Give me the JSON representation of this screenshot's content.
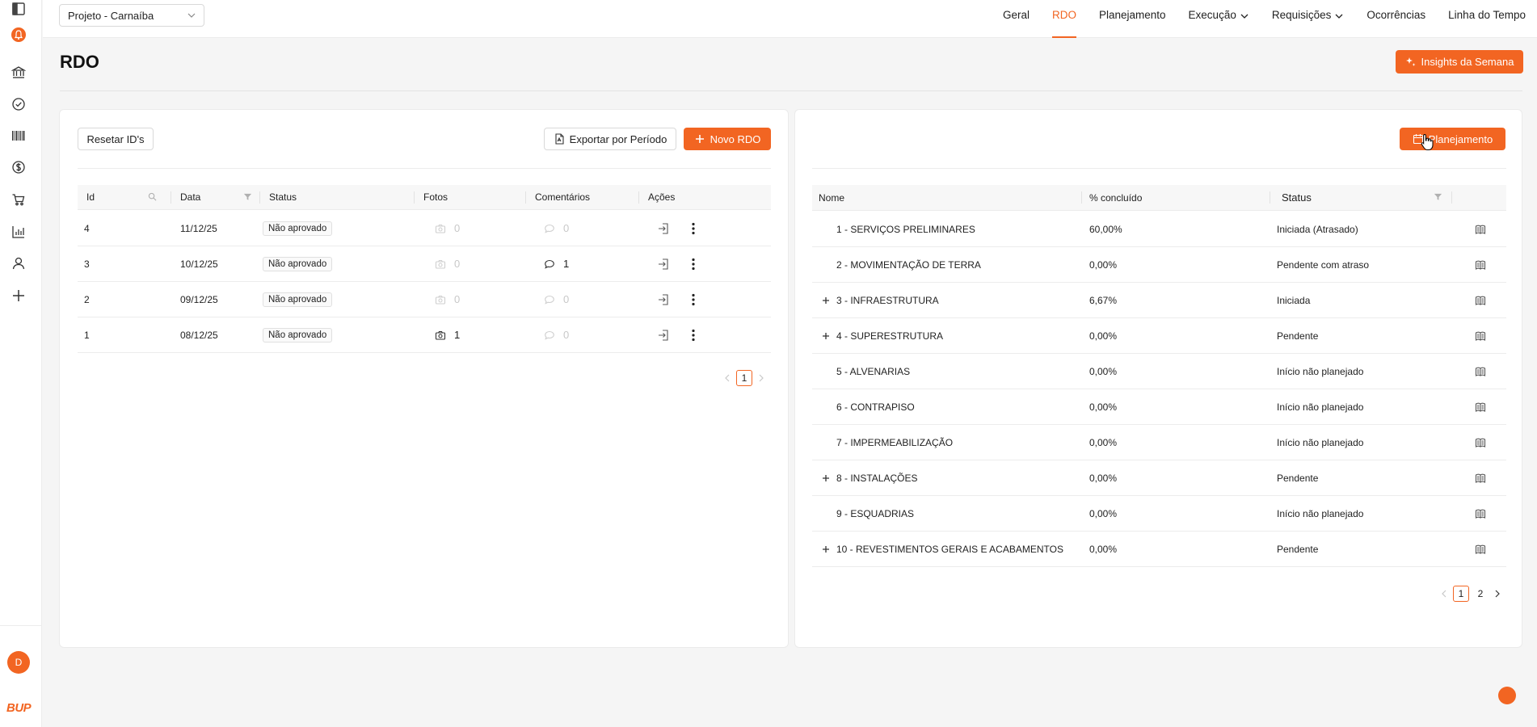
{
  "topbar": {
    "project": "Projeto - Carnaíba",
    "nav": [
      {
        "label": "Geral",
        "active": false,
        "dropdown": false
      },
      {
        "label": "RDO",
        "active": true,
        "dropdown": false
      },
      {
        "label": "Planejamento",
        "active": false,
        "dropdown": false
      },
      {
        "label": "Execução",
        "active": false,
        "dropdown": true
      },
      {
        "label": "Requisições",
        "active": false,
        "dropdown": true
      },
      {
        "label": "Ocorrências",
        "active": false,
        "dropdown": false
      },
      {
        "label": "Linha do Tempo",
        "active": false,
        "dropdown": false
      }
    ]
  },
  "sidebar": {
    "icons": [
      "panel-toggle-icon",
      "alert-bell-icon",
      "bank-icon",
      "check-circle-icon",
      "barcode-icon",
      "dollar-icon",
      "cart-icon",
      "bar-chart-icon",
      "user-icon",
      "plus-icon"
    ],
    "avatar_initial": "D",
    "logo_text": "BUP"
  },
  "page": {
    "title": "RDO",
    "insights_label": "Insights da Semana"
  },
  "rdo_panel": {
    "reset_label": "Resetar ID's",
    "export_label": "Exportar por Período",
    "new_label": "Novo RDO",
    "columns": [
      "Id",
      "Data",
      "Status",
      "Fotos",
      "Comentários",
      "Ações"
    ],
    "rows": [
      {
        "id": "4",
        "date": "11/12/25",
        "status": "Não aprovado",
        "photos": "0",
        "comments": "0"
      },
      {
        "id": "3",
        "date": "10/12/25",
        "status": "Não aprovado",
        "photos": "0",
        "comments": "1"
      },
      {
        "id": "2",
        "date": "09/12/25",
        "status": "Não aprovado",
        "photos": "0",
        "comments": "0"
      },
      {
        "id": "1",
        "date": "08/12/25",
        "status": "Não aprovado",
        "photos": "1",
        "comments": "0"
      }
    ],
    "pagination": {
      "current": "1"
    }
  },
  "planning_panel": {
    "button_label": "Planejamento",
    "columns": [
      "Nome",
      "% concluído",
      "Status"
    ],
    "rows": [
      {
        "name": "1 - SERVIÇOS PRELIMINARES",
        "pct": "60,00%",
        "status": "Iniciada (Atrasado)",
        "expandable": false
      },
      {
        "name": "2 - MOVIMENTAÇÃO DE TERRA",
        "pct": "0,00%",
        "status": "Pendente com atraso",
        "expandable": false
      },
      {
        "name": "3 - INFRAESTRUTURA",
        "pct": "6,67%",
        "status": "Iniciada",
        "expandable": true
      },
      {
        "name": "4 - SUPERESTRUTURA",
        "pct": "0,00%",
        "status": "Pendente",
        "expandable": true
      },
      {
        "name": "5 - ALVENARIAS",
        "pct": "0,00%",
        "status": "Início não planejado",
        "expandable": false
      },
      {
        "name": "6 - CONTRAPISO",
        "pct": "0,00%",
        "status": "Início não planejado",
        "expandable": false
      },
      {
        "name": "7 - IMPERMEABILIZAÇÃO",
        "pct": "0,00%",
        "status": "Início não planejado",
        "expandable": false
      },
      {
        "name": "8 - INSTALAÇÕES",
        "pct": "0,00%",
        "status": "Pendente",
        "expandable": true
      },
      {
        "name": "9 - ESQUADRIAS",
        "pct": "0,00%",
        "status": "Início não planejado",
        "expandable": false
      },
      {
        "name": "10 - REVESTIMENTOS GERAIS E ACABAMENTOS",
        "pct": "0,00%",
        "status": "Pendente",
        "expandable": true
      }
    ],
    "pagination": {
      "pages": [
        "1",
        "2"
      ],
      "current": "1"
    }
  },
  "colors": {
    "accent": "#f26522",
    "border": "#ececec",
    "background": "#f5f5f5"
  }
}
